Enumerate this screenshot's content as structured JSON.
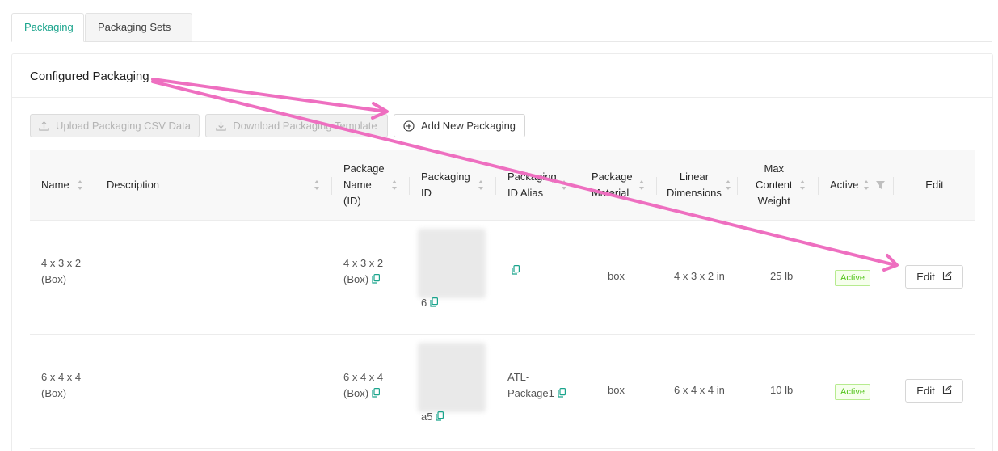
{
  "tabs": [
    {
      "label": "Packaging",
      "active": true
    },
    {
      "label": "Packaging Sets",
      "active": false
    }
  ],
  "card": {
    "title": "Configured Packaging"
  },
  "toolbar": {
    "upload_label": "Upload Packaging CSV Data",
    "download_label": "Download Packaging Template",
    "add_label": "Add New Packaging"
  },
  "columns": {
    "name": "Name",
    "description": "Description",
    "package_name": [
      "Package",
      "Name",
      "(ID)"
    ],
    "packaging_id": [
      "Packaging",
      "ID"
    ],
    "packaging_id_alias": [
      "Packaging",
      "ID Alias"
    ],
    "package_material": [
      "Package",
      "Material"
    ],
    "linear_dimensions": [
      "Linear",
      "Dimensions"
    ],
    "max_content_weight": [
      "Max",
      "Content",
      "Weight"
    ],
    "active": "Active",
    "edit": "Edit"
  },
  "rows": [
    {
      "name": [
        "4 x 3 x 2",
        "(Box)"
      ],
      "description": "",
      "package_name": [
        "4 x 3 x 2",
        "(Box)"
      ],
      "packaging_id_tail": "6",
      "packaging_id_alias": "",
      "material": "box",
      "dimensions": "4 x 3 x 2 in",
      "weight": "25 lb",
      "status": "Active",
      "edit_label": "Edit"
    },
    {
      "name": [
        "6 x 4 x 4",
        "(Box)"
      ],
      "description": "",
      "package_name": [
        "6 x 4 x 4",
        "(Box)"
      ],
      "packaging_id_tail": "a5",
      "packaging_id_alias": [
        "ATL-",
        "Package1"
      ],
      "material": "box",
      "dimensions": "6 x 4 x 4 in",
      "weight": "10 lb",
      "status": "Active",
      "edit_label": "Edit"
    }
  ],
  "colors": {
    "accent": "#1aa48c",
    "annotation_arrow": "#ee6fc0",
    "active_badge_text": "#52c41a",
    "active_badge_bg": "#f6ffed",
    "active_badge_border": "#b7eb8f"
  },
  "icons": [
    "upload-icon",
    "download-icon",
    "plus-circle-icon",
    "sort-icon",
    "filter-icon",
    "copy-icon",
    "edit-icon"
  ]
}
